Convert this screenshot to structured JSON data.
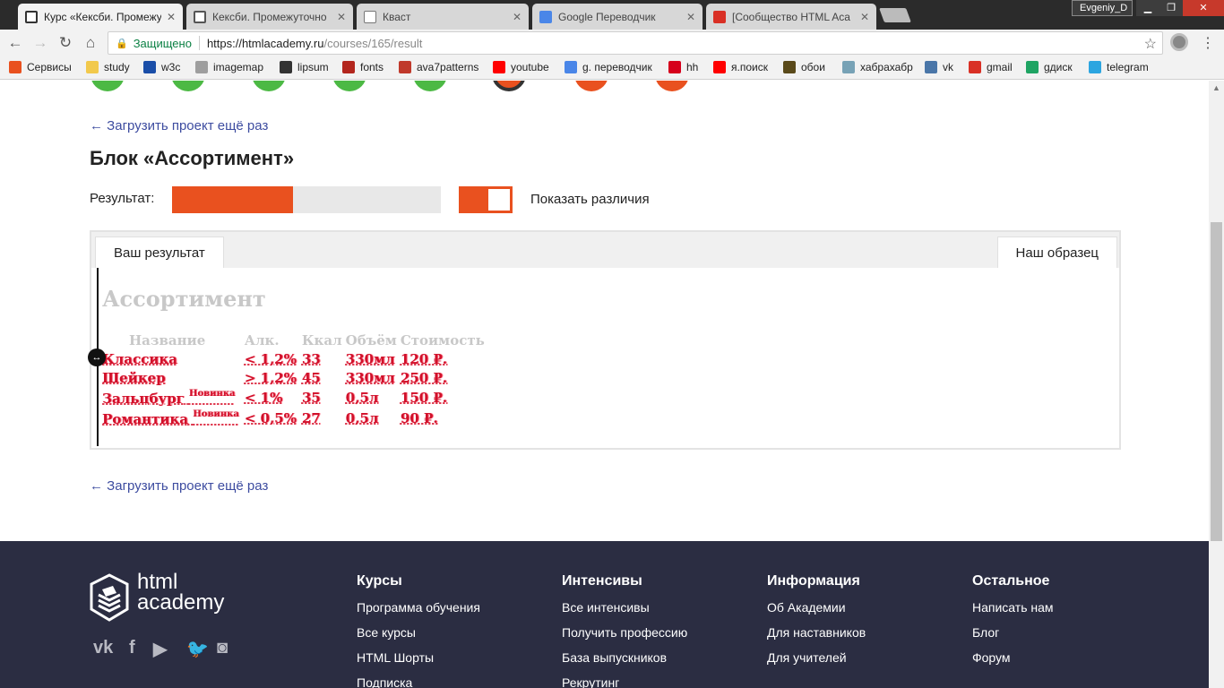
{
  "browser": {
    "tabs": [
      {
        "title": "Курс «Кексби. Промежу",
        "favicon_color": "#2b2b2b",
        "active": true
      },
      {
        "title": "Кексби. Промежуточно",
        "favicon_color": "#555555",
        "active": false
      },
      {
        "title": "Кваст",
        "favicon_color": "#ffffff",
        "active": false
      },
      {
        "title": "Google Переводчик",
        "favicon_color": "#4a86e8",
        "active": false
      },
      {
        "title": "[Сообщество HTML Aca",
        "favicon_color": "#d93025",
        "active": false
      }
    ],
    "user": "Evgeniy_D",
    "secure_label": "Защищено",
    "url_main": "https://htmlacademy.ru",
    "url_path": "/courses/165/result",
    "bookmarks": [
      {
        "label": "Сервисы",
        "icon": "apps-icon",
        "color": "#e9511f"
      },
      {
        "label": "study",
        "icon": "folder-icon",
        "color": "#f2c94c"
      },
      {
        "label": "w3c",
        "icon": "w3c-icon",
        "color": "#1a4ea8"
      },
      {
        "label": "imagemap",
        "icon": "page-icon",
        "color": "#9e9e9e"
      },
      {
        "label": "lipsum",
        "icon": "lipsum-icon",
        "color": "#333333"
      },
      {
        "label": "fonts",
        "icon": "amp-icon",
        "color": "#b3261e"
      },
      {
        "label": "ava7patterns",
        "icon": "pattern-icon",
        "color": "#c0392b"
      },
      {
        "label": "youtube",
        "icon": "youtube-icon",
        "color": "#ff0000"
      },
      {
        "label": "g. переводчик",
        "icon": "translate-icon",
        "color": "#4a86e8"
      },
      {
        "label": "hh",
        "icon": "hh-icon",
        "color": "#d6001c"
      },
      {
        "label": "я.поиск",
        "icon": "yandex-icon",
        "color": "#ff0000"
      },
      {
        "label": "обои",
        "icon": "grid-icon",
        "color": "#5a4a1a"
      },
      {
        "label": "хабрахабр",
        "icon": "habr-icon",
        "color": "#77a2b6"
      },
      {
        "label": "vk",
        "icon": "vk-icon",
        "color": "#4a76a8"
      },
      {
        "label": "gmail",
        "icon": "gmail-icon",
        "color": "#d93025"
      },
      {
        "label": "gдиск",
        "icon": "drive-icon",
        "color": "#1fa463"
      },
      {
        "label": "telegram",
        "icon": "telegram-icon",
        "color": "#2ca5e0"
      }
    ]
  },
  "progress_dots": [
    "#4cb944",
    "#4cb944",
    "#4cb944",
    "#4cb944",
    "#4cb944",
    "#e9511f",
    "#e9511f",
    "#e9511f"
  ],
  "page": {
    "reload_link": "← Загрузить проект ещё раз",
    "block_title": "Блок «Ассортимент»",
    "result_label": "Результат:",
    "result_fraction": 0.45,
    "show_diff_label": "Показать различия",
    "show_diff_on": true,
    "tab_yours": "Ваш результат",
    "tab_sample": "Наш образец"
  },
  "preview": {
    "heading": "Ассортимент",
    "columns": [
      "Название",
      "Алк.",
      "Ккал",
      "Объём",
      "Стоимость"
    ],
    "rows": [
      {
        "name": "Классика",
        "tag": "",
        "alc": "< 1,2%",
        "kcal": "33",
        "vol": "330мл",
        "price": "120 ₽."
      },
      {
        "name": "Шейкер",
        "tag": "",
        "alc": "> 1,2%",
        "kcal": "45",
        "vol": "330мл",
        "price": "250 ₽."
      },
      {
        "name": "Зальцбург",
        "tag": "Новинка",
        "alc": "< 1%",
        "kcal": "35",
        "vol": "0,5л",
        "price": "150 ₽."
      },
      {
        "name": "Романтика",
        "tag": "Новинка",
        "alc": "< 0,5%",
        "kcal": "27",
        "vol": "0,5л",
        "price": "90 ₽."
      }
    ]
  },
  "footer": {
    "logo_line1": "html",
    "logo_line2": "academy",
    "social": [
      {
        "icon": "vk-icon",
        "glyph": "vk"
      },
      {
        "icon": "facebook-icon",
        "glyph": "f"
      },
      {
        "icon": "youtube-icon",
        "glyph": "▶"
      },
      {
        "icon": "twitter-icon",
        "glyph": "🐦"
      },
      {
        "icon": "instagram-icon",
        "glyph": "◙"
      }
    ],
    "columns": [
      {
        "title": "Курсы",
        "items": [
          "Программа обучения",
          "Все курсы",
          "HTML Шорты",
          "Подписка"
        ]
      },
      {
        "title": "Интенсивы",
        "items": [
          "Все интенсивы",
          "Получить профессию",
          "База выпускников",
          "Рекрутинг"
        ]
      },
      {
        "title": "Информация",
        "items": [
          "Об Академии",
          "Для наставников",
          "Для учителей"
        ]
      },
      {
        "title": "Остальное",
        "items": [
          "Написать нам",
          "Блог",
          "Форум"
        ]
      }
    ]
  }
}
